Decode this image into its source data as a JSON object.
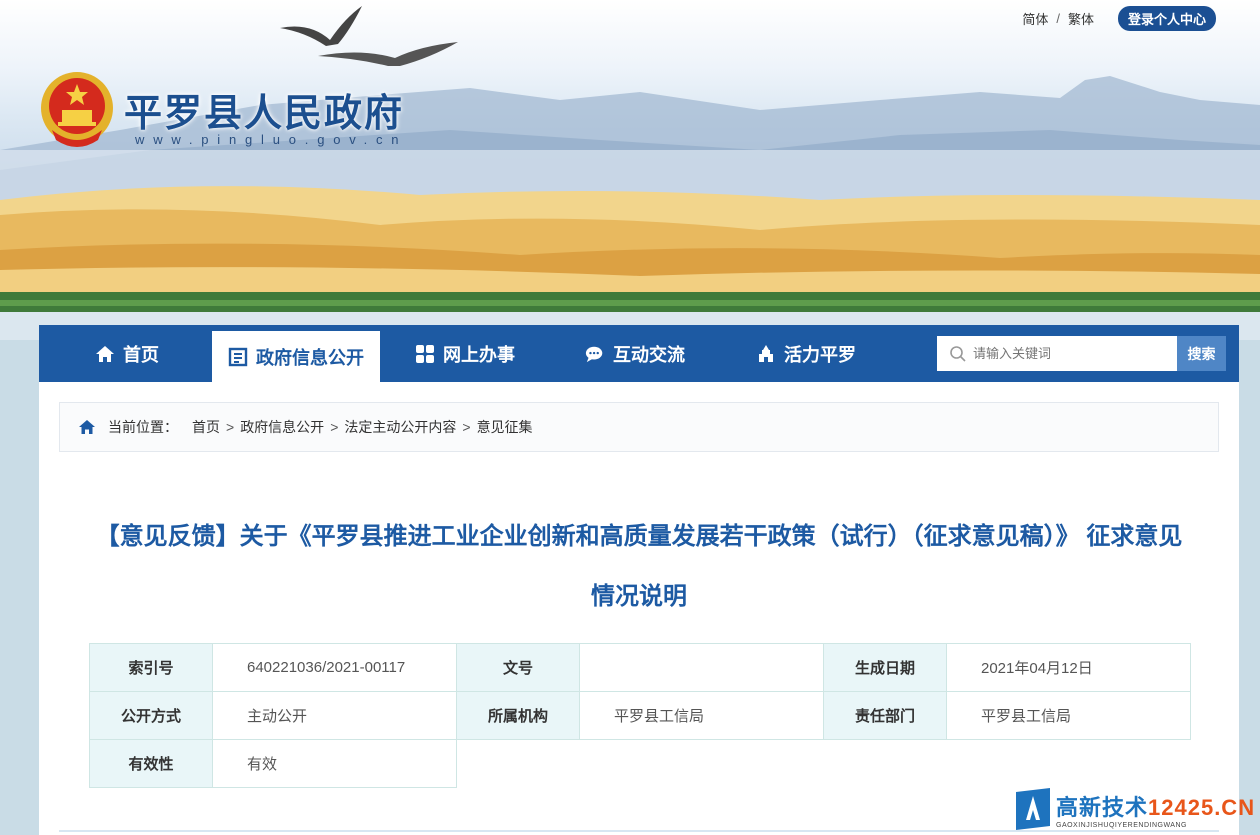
{
  "top_links": {
    "simplified": "简体",
    "separator": "/",
    "traditional": "繁体",
    "login": "登录个人中心"
  },
  "site": {
    "title": "平罗县人民政府",
    "url": "www.pingluo.gov.cn"
  },
  "nav": {
    "items": [
      {
        "label": "首页",
        "icon": "home-icon"
      },
      {
        "label": "政府信息公开",
        "icon": "document-icon",
        "active": true
      },
      {
        "label": "网上办事",
        "icon": "grid-icon"
      },
      {
        "label": "互动交流",
        "icon": "chat-icon"
      },
      {
        "label": "活力平罗",
        "icon": "building-icon"
      }
    ],
    "search_placeholder": "请输入关键词",
    "search_button": "搜索"
  },
  "breadcrumb": {
    "prefix": "当前位置：",
    "items": [
      "首页",
      "政府信息公开",
      "法定主动公开内容",
      "意见征集"
    ],
    "separator": ">"
  },
  "article": {
    "title_line1": "【意见反馈】关于《平罗县推进工业企业创新和高质量发展若干政策（试行）（征求意见稿）》 征求意见",
    "title_line2": "情况说明"
  },
  "meta": {
    "index_label": "索引号",
    "index_value": "640221036/2021-00117",
    "docno_label": "文号",
    "docno_value": "",
    "date_label": "生成日期",
    "date_value": "2021年04月12日",
    "method_label": "公开方式",
    "method_value": "主动公开",
    "org_label": "所属机构",
    "org_value": "平罗县工信局",
    "dept_label": "责任部门",
    "dept_value": "平罗县工信局",
    "validity_label": "有效性",
    "validity_value": "有效"
  },
  "watermark": {
    "main_a": "高新技术",
    "main_b": "12425.CN",
    "sub": "GAOXINJISHUQIYERENDINGWANG"
  },
  "colors": {
    "brand_blue": "#1d5aa3",
    "title_blue": "#1c4f8f",
    "table_header_bg": "#e9f6f8"
  }
}
